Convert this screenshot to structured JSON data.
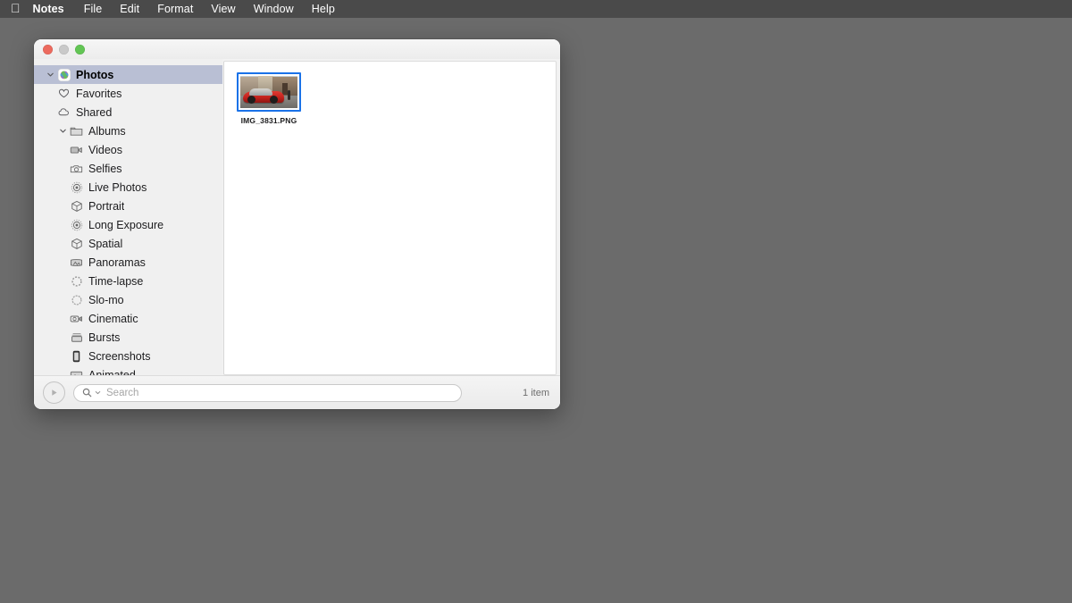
{
  "menubar": {
    "apple_icon": "apple-logo-icon",
    "items": [
      {
        "label": "Notes",
        "bold": true
      },
      {
        "label": "File"
      },
      {
        "label": "Edit"
      },
      {
        "label": "Format"
      },
      {
        "label": "View"
      },
      {
        "label": "Window"
      },
      {
        "label": "Help"
      }
    ]
  },
  "window": {
    "controls": {
      "close": "close-button",
      "minimize": "minimize-button",
      "maximize": "maximize-button"
    },
    "sidebar": {
      "items": [
        {
          "label": "Photos",
          "icon": "photos-app-icon",
          "level": 0,
          "chevron": "down",
          "selected": true
        },
        {
          "label": "Favorites",
          "icon": "heart-icon",
          "level": 1,
          "chevron": "",
          "selected": false
        },
        {
          "label": "Shared",
          "icon": "cloud-icon",
          "level": 1,
          "chevron": "",
          "selected": false
        },
        {
          "label": "Albums",
          "icon": "folder-icon",
          "level": 0,
          "chevron": "down",
          "selected": false
        },
        {
          "label": "Videos",
          "icon": "video-camera-icon",
          "level": 2,
          "chevron": "",
          "selected": false
        },
        {
          "label": "Selfies",
          "icon": "camera-icon",
          "level": 2,
          "chevron": "",
          "selected": false
        },
        {
          "label": "Live Photos",
          "icon": "live-photo-icon",
          "level": 2,
          "chevron": "",
          "selected": false
        },
        {
          "label": "Portrait",
          "icon": "cube-icon",
          "level": 2,
          "chevron": "",
          "selected": false
        },
        {
          "label": "Long Exposure",
          "icon": "live-photo-icon",
          "level": 2,
          "chevron": "",
          "selected": false
        },
        {
          "label": "Spatial",
          "icon": "cube-icon",
          "level": 2,
          "chevron": "",
          "selected": false
        },
        {
          "label": "Panoramas",
          "icon": "panorama-icon",
          "level": 2,
          "chevron": "",
          "selected": false
        },
        {
          "label": "Time-lapse",
          "icon": "timelapse-icon",
          "level": 2,
          "chevron": "",
          "selected": false
        },
        {
          "label": "Slo-mo",
          "icon": "slomo-icon",
          "level": 2,
          "chevron": "",
          "selected": false
        },
        {
          "label": "Cinematic",
          "icon": "cinematic-icon",
          "level": 2,
          "chevron": "",
          "selected": false
        },
        {
          "label": "Bursts",
          "icon": "bursts-icon",
          "level": 2,
          "chevron": "",
          "selected": false
        },
        {
          "label": "Screenshots",
          "icon": "screenshot-icon",
          "level": 2,
          "chevron": "",
          "selected": false
        },
        {
          "label": "Animated",
          "icon": "animated-icon",
          "level": 2,
          "chevron": "",
          "selected": false
        }
      ]
    },
    "content": {
      "files": [
        {
          "name": "IMG_3831.PNG",
          "selected": true,
          "thumbnail": "red-classic-car-street-photo"
        }
      ]
    },
    "bottombar": {
      "play_icon": "play-button-icon",
      "search": {
        "icon": "search-magnifier-icon",
        "chevron": "chevron-down-icon",
        "value": "",
        "placeholder": "Search"
      },
      "item_count": "1 item"
    }
  },
  "colors": {
    "menubar_bg": "#4a4a4a",
    "desktop_bg": "#6b6b6b",
    "sidebar_bg": "#f0f0f0",
    "selection_bg": "#b9bfd4",
    "selection_border": "#1a72e8",
    "window_bg": "#f2f2f2"
  }
}
